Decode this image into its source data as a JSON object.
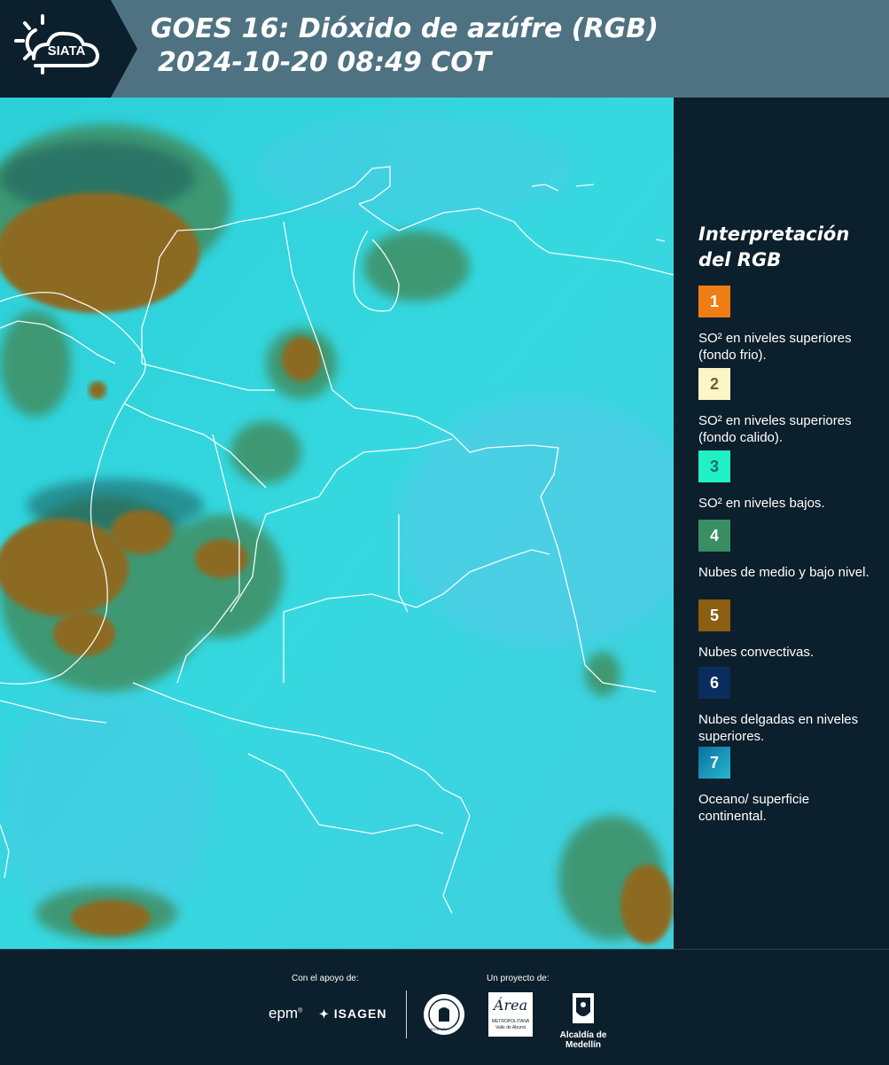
{
  "header": {
    "logo_text": "SIATA",
    "title_line1": "GOES 16: Dióxido de azúfre (RGB)",
    "title_line2": "2024-10-20 08:49 COT"
  },
  "legend": {
    "title_line1": "Interpretación",
    "title_line2": "del RGB",
    "items": [
      {
        "number": "1",
        "color": "#f07d14",
        "text": "SO² en niveles superiores (fondo frio)."
      },
      {
        "number": "2",
        "color": "#fcf5c6",
        "text": "SO² en niveles superiores (fondo calido)."
      },
      {
        "number": "3",
        "color": "#20f0c6",
        "text": "SO² en niveles bajos."
      },
      {
        "number": "4",
        "color": "#3a8e64",
        "text": "Nubes de medio y bajo nivel."
      },
      {
        "number": "5",
        "color": "#8c5e12",
        "text": "Nubes convectivas."
      },
      {
        "number": "6",
        "color": "#0b2d5e",
        "text": "Nubes delgadas en niveles superiores."
      },
      {
        "number": "7",
        "color": "#1aa0c0",
        "text": "Oceano/ superficie continental."
      }
    ]
  },
  "footer": {
    "support_label": "Con el apoyo de:",
    "project_label": "Un proyecto de:",
    "epm": "epm",
    "isagen": "ISAGEN",
    "area_word": "Área",
    "area_sub": "METROPOLITANA",
    "area_sub2": "Valle de Aburrá",
    "alcaldia": "Alcaldía de Medellín",
    "seal_text": "MEDELLÍN"
  },
  "colors": {
    "background": "#0c1f2c",
    "header": "#4f7282",
    "map_base": "#2fd3db",
    "convective": "#8c6a22",
    "mid_cloud": "#3f8e62"
  }
}
